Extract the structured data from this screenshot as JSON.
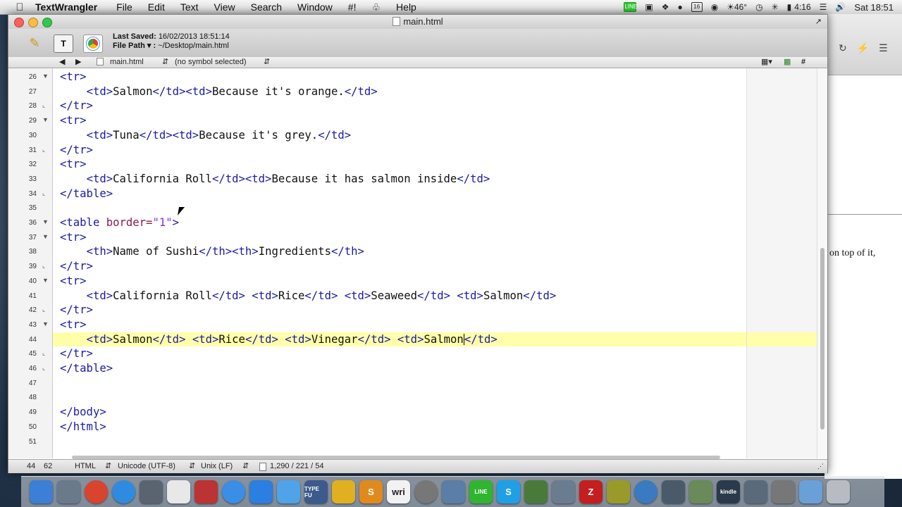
{
  "menubar": {
    "app_name": "TextWrangler",
    "menus": [
      "File",
      "Edit",
      "Text",
      "View",
      "Search",
      "Window",
      "#!",
      "Help"
    ],
    "status": {
      "line_badge": "LINE",
      "calendar_day": "16",
      "temperature": "46°",
      "battery_icon": "battery-icon",
      "time": "4:16",
      "clock": "Sat 18:51"
    }
  },
  "window": {
    "title": "main.html",
    "last_saved_label": "Last Saved:",
    "last_saved_value": "16/02/2013 18:51:14",
    "file_path_label": "File Path ▾ :",
    "file_path_value": "~/Desktop/main.html",
    "nav_file": "main.html",
    "nav_symbol": "(no symbol selected)",
    "nav_hash": "#"
  },
  "code_lines": [
    {
      "n": "26",
      "fold": "▼",
      "html": "<span class=\"tg\">&lt;tr&gt;</span>"
    },
    {
      "n": "27",
      "fold": "",
      "html": "    <span class=\"tg\">&lt;td&gt;</span>Salmon<span class=\"tg\">&lt;/td&gt;&lt;td&gt;</span>Because it's orange.<span class=\"tg\">&lt;/td&gt;</span>"
    },
    {
      "n": "28",
      "fold": "⌞",
      "html": "<span class=\"tg\">&lt;/tr&gt;</span>"
    },
    {
      "n": "29",
      "fold": "▼",
      "html": "<span class=\"tg\">&lt;tr&gt;</span>"
    },
    {
      "n": "30",
      "fold": "",
      "html": "    <span class=\"tg\">&lt;td&gt;</span>Tuna<span class=\"tg\">&lt;/td&gt;&lt;td&gt;</span>Because it's grey.<span class=\"tg\">&lt;/td&gt;</span>"
    },
    {
      "n": "31",
      "fold": "⌞",
      "html": "<span class=\"tg\">&lt;/tr&gt;</span>"
    },
    {
      "n": "32",
      "fold": "",
      "html": "<span class=\"tg\">&lt;tr&gt;</span>"
    },
    {
      "n": "33",
      "fold": "",
      "html": "    <span class=\"tg\">&lt;td&gt;</span>California Roll<span class=\"tg\">&lt;/td&gt;&lt;td&gt;</span>Because it has salmon inside<span class=\"tg\">&lt;/td&gt;</span>"
    },
    {
      "n": "34",
      "fold": "⌞",
      "html": "<span class=\"tg\">&lt;/table&gt;</span>"
    },
    {
      "n": "35",
      "fold": "",
      "html": ""
    },
    {
      "n": "36",
      "fold": "▼",
      "html": "<span class=\"tg\">&lt;table </span><span class=\"at\">border=</span><span class=\"st2\">\"1\"</span><span class=\"tg\">&gt;</span>"
    },
    {
      "n": "37",
      "fold": "▼",
      "html": "<span class=\"tg\">&lt;tr&gt;</span>"
    },
    {
      "n": "38",
      "fold": "",
      "html": "    <span class=\"tg\">&lt;th&gt;</span>Name of Sushi<span class=\"tg\">&lt;/th&gt;&lt;th&gt;</span>Ingredients<span class=\"tg\">&lt;/th&gt;</span>"
    },
    {
      "n": "39",
      "fold": "⌞",
      "html": "<span class=\"tg\">&lt;/tr&gt;</span>"
    },
    {
      "n": "40",
      "fold": "▼",
      "html": "<span class=\"tg\">&lt;tr&gt;</span>"
    },
    {
      "n": "41",
      "fold": "",
      "html": "    <span class=\"tg\">&lt;td&gt;</span>California Roll<span class=\"tg\">&lt;/td&gt;</span> <span class=\"tg\">&lt;td&gt;</span>Rice<span class=\"tg\">&lt;/td&gt;</span> <span class=\"tg\">&lt;td&gt;</span>Seaweed<span class=\"tg\">&lt;/td&gt;</span> <span class=\"tg\">&lt;td&gt;</span>Salmon<span class=\"tg\">&lt;/td&gt;</span>"
    },
    {
      "n": "42",
      "fold": "⌞",
      "html": "<span class=\"tg\">&lt;/tr&gt;</span>"
    },
    {
      "n": "43",
      "fold": "▼",
      "html": "<span class=\"tg\">&lt;tr&gt;</span>"
    },
    {
      "n": "44",
      "fold": "",
      "html": "    <span class=\"tg\">&lt;td&gt;</span>Salmon<span class=\"tg\">&lt;/td&gt;</span> <span class=\"tg\">&lt;td&gt;</span>Rice<span class=\"tg\">&lt;/td&gt;</span> <span class=\"tg\">&lt;td&gt;</span>Vinegar<span class=\"tg\">&lt;/td&gt;</span> <span class=\"tg\">&lt;td&gt;</span>Salmon<span id=\"cursor\"></span><span class=\"tg\">&lt;/td&gt;</span>",
      "highlight": true
    },
    {
      "n": "45",
      "fold": "⌞",
      "html": "<span class=\"tg\">&lt;/tr&gt;</span>"
    },
    {
      "n": "46",
      "fold": "⌞",
      "html": "<span class=\"tg\">&lt;/table&gt;</span>"
    },
    {
      "n": "47",
      "fold": "",
      "html": ""
    },
    {
      "n": "48",
      "fold": "",
      "html": ""
    },
    {
      "n": "49",
      "fold": "",
      "html": "<span class=\"tg\">&lt;/body&gt;</span>"
    },
    {
      "n": "50",
      "fold": "",
      "html": "<span class=\"tg\">&lt;/html&gt;</span>"
    },
    {
      "n": "51",
      "fold": "",
      "html": ""
    }
  ],
  "statusbar": {
    "line": "44",
    "column": "62",
    "language": "HTML",
    "encoding": "Unicode (UTF-8)",
    "line_endings": "Unix (LF)",
    "doc_stats": "1,290 / 221 / 54"
  },
  "background_window": {
    "text": "on top of it,"
  },
  "dock": {
    "items": [
      {
        "icon": "finder-icon",
        "label": "",
        "color": "#3b7fd6"
      },
      {
        "icon": "launchpad-icon",
        "label": "",
        "color": "#6b7a8a"
      },
      {
        "icon": "chrome-icon",
        "label": "",
        "color": "#d9442f"
      },
      {
        "icon": "safari-icon",
        "label": "",
        "color": "#2f8be0"
      },
      {
        "icon": "utility-icon",
        "label": "",
        "color": "#5a6470"
      },
      {
        "icon": "notes-icon",
        "label": "",
        "color": "#e8e8e8"
      },
      {
        "icon": "script-icon",
        "label": "",
        "color": "#b33"
      },
      {
        "icon": "itunes-icon",
        "label": "",
        "color": "#3a8ee6"
      },
      {
        "icon": "appstore-icon",
        "label": "",
        "color": "#2a7fe0"
      },
      {
        "icon": "dropbox-icon",
        "label": "",
        "color": "#4fa3e8"
      },
      {
        "icon": "typefu-icon",
        "label": "TYPE FU",
        "color": "#3c5a8c"
      },
      {
        "icon": "wrangler-icon",
        "label": "",
        "color": "#e0b020"
      },
      {
        "icon": "sublime-icon",
        "label": "S",
        "color": "#e08a1e"
      },
      {
        "icon": "writer-icon",
        "label": "wri",
        "color": "#f2f2f2"
      },
      {
        "icon": "network-icon",
        "label": "",
        "color": "#777"
      },
      {
        "icon": "preview-icon",
        "label": "",
        "color": "#5a7ea6"
      },
      {
        "icon": "line-app-icon",
        "label": "LINE",
        "color": "#2fb52f"
      },
      {
        "icon": "skype-icon",
        "label": "S",
        "color": "#1fa0e6"
      },
      {
        "icon": "evernote-icon",
        "label": "",
        "color": "#4a7a3a"
      },
      {
        "icon": "xcode-icon",
        "label": "",
        "color": "#6a7c90"
      },
      {
        "icon": "filezilla-icon",
        "label": "Z",
        "color": "#c41e1e"
      },
      {
        "icon": "transmit-icon",
        "label": "",
        "color": "#9a9a2a"
      },
      {
        "icon": "vlc-icon",
        "label": "",
        "color": "#3a7ac0"
      },
      {
        "icon": "photo-icon",
        "label": "",
        "color": "#4a5a6a"
      },
      {
        "icon": "grapher-icon",
        "label": "",
        "color": "#6a8a5a"
      },
      {
        "icon": "kindle-icon",
        "label": "kindle",
        "color": "#2b3a4a"
      },
      {
        "icon": "disk-icon",
        "label": "",
        "color": "#5a6a7a"
      },
      {
        "icon": "preferences-icon",
        "label": "",
        "color": "#777"
      },
      {
        "icon": "folder-icon",
        "label": "",
        "color": "#6aa0d8"
      },
      {
        "icon": "trash-icon",
        "label": "",
        "color": "#b8bcc2"
      }
    ]
  }
}
